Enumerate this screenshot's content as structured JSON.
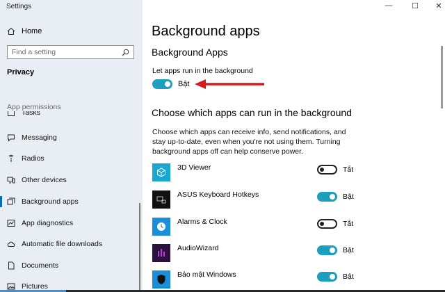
{
  "window": {
    "title": "Settings",
    "minimize": "—",
    "maximize": "☐",
    "close": "✕"
  },
  "sidebar": {
    "home_label": "Home",
    "search_placeholder": "Find a setting",
    "category": "Privacy",
    "section_label": "App permissions",
    "partial_item": "Tasks",
    "items": [
      {
        "label": "Messaging",
        "icon": "messaging-icon"
      },
      {
        "label": "Radios",
        "icon": "radios-icon"
      },
      {
        "label": "Other devices",
        "icon": "other-devices-icon"
      },
      {
        "label": "Background apps",
        "icon": "background-apps-icon",
        "active": true
      },
      {
        "label": "App diagnostics",
        "icon": "app-diagnostics-icon"
      },
      {
        "label": "Automatic file downloads",
        "icon": "cloud-icon"
      },
      {
        "label": "Documents",
        "icon": "document-icon"
      },
      {
        "label": "Pictures",
        "icon": "pictures-icon"
      }
    ]
  },
  "main": {
    "page_title": "Background apps",
    "section_title": "Background Apps",
    "let_run_label": "Let apps run in the background",
    "master_toggle": {
      "state": "on",
      "label": "Bật"
    },
    "choose_title": "Choose which apps can run in the background",
    "description": "Choose which apps can receive info, send notifications, and stay up-to-date, even when you're not using them. Turning background apps off can help conserve power.",
    "apps": [
      {
        "name": "3D Viewer",
        "state": "off",
        "toggle_label": "Tắt",
        "tile_color": "#19a7cf"
      },
      {
        "name": "ASUS Keyboard Hotkeys",
        "state": "on",
        "toggle_label": "Bật",
        "tile_color": "#111111"
      },
      {
        "name": "Alarms & Clock",
        "state": "off",
        "toggle_label": "Tắt",
        "tile_color": "#1a8fd9"
      },
      {
        "name": "AudioWizard",
        "state": "on",
        "toggle_label": "Bật",
        "tile_color": "#2a1140"
      },
      {
        "name": "Bảo mật Windows",
        "state": "on",
        "toggle_label": "Bật",
        "tile_color": "#1a8fd9"
      }
    ]
  },
  "colors": {
    "accent": "#1b9fbd",
    "sidebar_bg": "#e8eef3",
    "arrow": "#d71920"
  }
}
